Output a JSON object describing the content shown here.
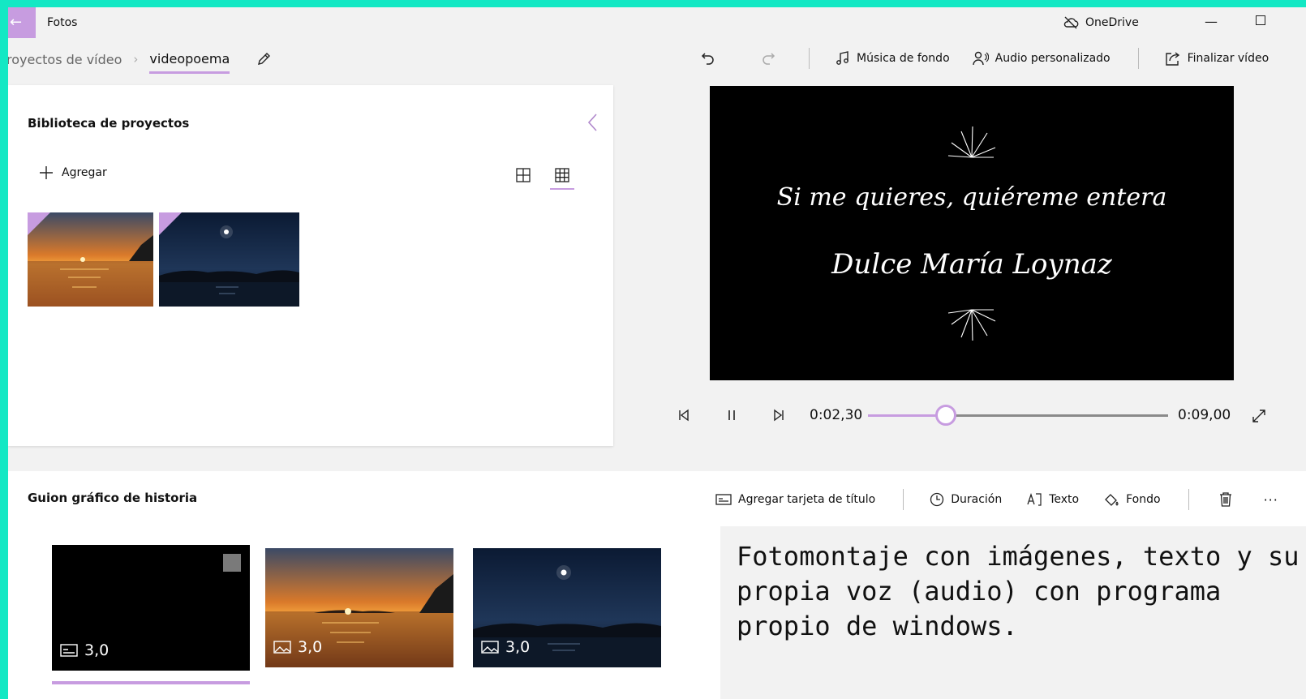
{
  "titlebar": {
    "app_title": "Fotos",
    "onedrive_label": "OneDrive",
    "minimize_glyph": "—",
    "back_glyph": "←"
  },
  "breadcrumb": {
    "parent": "royectos de vídeo",
    "separator": "›",
    "current": "videopoema"
  },
  "toolbar": {
    "music_label": "Música de fondo",
    "custom_audio_label": "Audio personalizado",
    "finish_label": "Finalizar vídeo"
  },
  "library": {
    "title": "Biblioteca de proyectos",
    "add_label": "Agregar",
    "items": [
      "sunset",
      "moonlight"
    ]
  },
  "preview": {
    "line1": "Si me quieres, quiéreme entera",
    "line2": "Dulce María Loynaz"
  },
  "playback": {
    "current_time": "0:02,30",
    "total_time": "0:09,00",
    "progress": 0.26
  },
  "storyboard": {
    "title": "Guion gráfico de historia",
    "add_title_card_label": "Agregar tarjeta de título",
    "duration_label": "Duración",
    "text_label": "Texto",
    "background_label": "Fondo",
    "more_glyph": "···",
    "clips": [
      {
        "type": "title-card",
        "duration": "3,0"
      },
      {
        "type": "image",
        "duration": "3,0"
      },
      {
        "type": "image",
        "duration": "3,0"
      }
    ]
  },
  "caption": {
    "text": "Fotomontaje con imágenes, texto y su propia voz (audio) con programa propio de windows."
  },
  "colors": {
    "accent": "#c79ce0",
    "frame": "#13e8c4",
    "panel_bg": "#f2f2f2"
  }
}
